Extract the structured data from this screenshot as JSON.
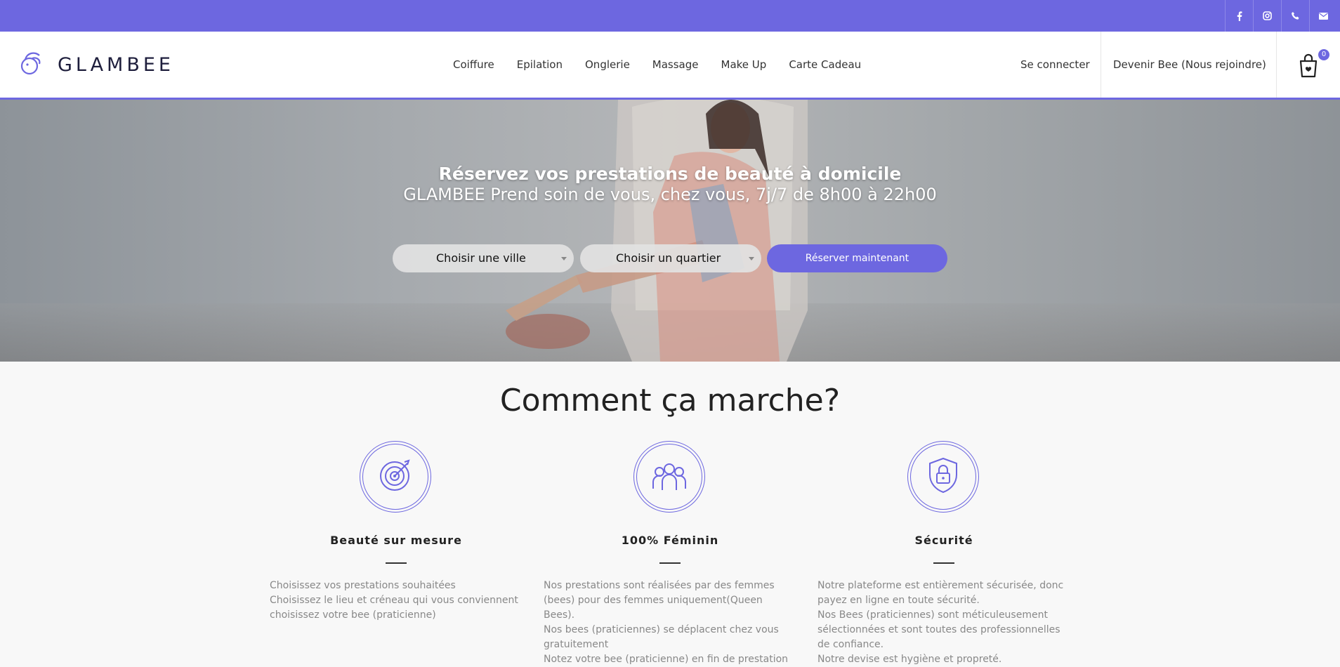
{
  "topbar": {
    "social_icons": [
      "facebook-icon",
      "instagram-icon",
      "phone-icon",
      "email-icon"
    ],
    "color": "#6d67e0"
  },
  "header": {
    "logo_text": "GLAMBEE",
    "nav": [
      "Coiffure",
      "Epilation",
      "Onglerie",
      "Massage",
      "Make Up",
      "Carte Cadeau"
    ],
    "login": "Se connecter",
    "join": "Devenir Bee (Nous rejoindre)",
    "cart_count": "0"
  },
  "hero": {
    "title": "Réservez vos prestations de beauté à domicile",
    "subtitle": "GLAMBEE Prend soin de vous, chez vous, 7j/7 de 8h00 à 22h00",
    "city_select": "Choisir une ville",
    "district_select": "Choisir un quartier",
    "book_button": "Réserver maintenant"
  },
  "how": {
    "title": "Comment ça marche?",
    "features": [
      {
        "icon": "target-icon",
        "title": "Beauté sur mesure",
        "lines": [
          "Choisissez vos prestations souhaitées",
          "Choisissez le lieu et créneau qui vous conviennent",
          "choisissez votre bee (praticienne)"
        ]
      },
      {
        "icon": "women-group-icon",
        "title": "100% Féminin",
        "lines": [
          "Nos prestations sont réalisées par des femmes (bees) pour des femmes uniquement(Queen Bees).",
          "Nos bees (praticiennes) se déplacent chez vous gratuitement",
          "Notez votre bee (praticienne) en fin de prestation"
        ]
      },
      {
        "icon": "shield-lock-icon",
        "title": "Sécurité",
        "lines": [
          "Notre plateforme est entièrement sécurisée, donc payez en ligne en toute sécurité.",
          "Nos Bees (praticiennes) sont méticuleusement sélectionnées et sont toutes des professionnelles de confiance.",
          "Notre devise est hygiène et propreté."
        ]
      }
    ]
  }
}
